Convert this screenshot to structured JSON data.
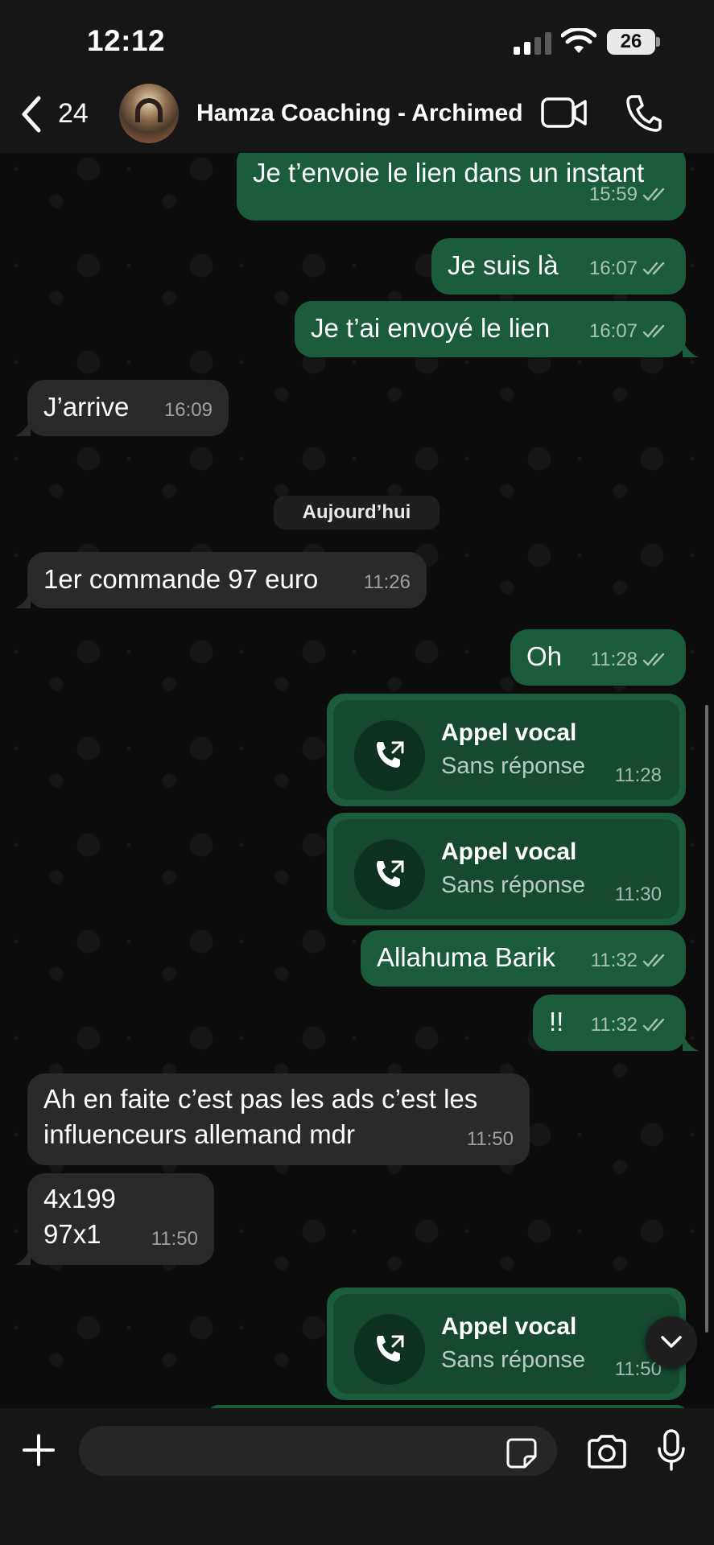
{
  "status_bar": {
    "time": "12:12",
    "battery": "26"
  },
  "header": {
    "back_count": "24",
    "contact_name": "Hamza Coaching - Archimed"
  },
  "date_separator": "Aujourd’hui",
  "messages": [
    {
      "dir": "out",
      "text": "Je t’envoie le lien dans un instant",
      "time": "15:59"
    },
    {
      "dir": "out",
      "text": "Je suis là",
      "time": "16:07"
    },
    {
      "dir": "out",
      "text": "Je t’ai envoyé le lien",
      "time": "16:07"
    },
    {
      "dir": "in",
      "text": "J’arrive",
      "time": "16:09"
    },
    {
      "dir": "in",
      "text": "1er commande 97 euro",
      "time": "11:26"
    },
    {
      "dir": "out",
      "text": "Oh",
      "time": "11:28"
    },
    {
      "dir": "out",
      "text": "Allahuma Barik",
      "time": "11:32"
    },
    {
      "dir": "out",
      "text": "!!",
      "time": "11:32"
    },
    {
      "dir": "in",
      "text": "Ah en faite c’est pas les ads c’est les\ninfluenceurs allemand mdr",
      "time": "11:50"
    },
    {
      "dir": "in",
      "text": "4x199\n97x1",
      "time": "11:50"
    }
  ],
  "calls": [
    {
      "title": "Appel vocal",
      "status": "Sans réponse",
      "time": "11:28"
    },
    {
      "title": "Appel vocal",
      "status": "Sans réponse",
      "time": "11:30"
    },
    {
      "title": "Appel vocal",
      "status": "Sans réponse",
      "time": "11:50"
    }
  ],
  "colors": {
    "outgoing_bubble": "#1a5c3c",
    "incoming_bubble": "#2a2a2a",
    "background": "#0c0c0c"
  },
  "icons": [
    "back-chevron-icon",
    "video-call-icon",
    "phone-icon",
    "plus-icon",
    "sticker-icon",
    "camera-icon",
    "microphone-icon",
    "chevron-down-icon",
    "missed-call-icon",
    "read-receipt-icon"
  ]
}
